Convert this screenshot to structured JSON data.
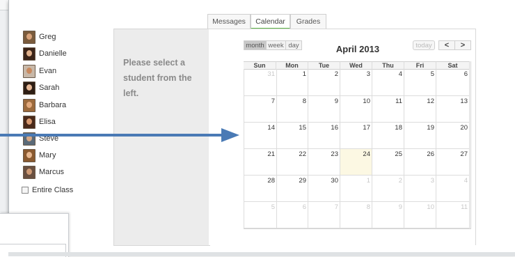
{
  "students": [
    {
      "name": "Greg",
      "avatar_bg": "#7a5b3c",
      "avatar_face": "#d8a27a"
    },
    {
      "name": "Danielle",
      "avatar_bg": "#3b2418",
      "avatar_face": "#e0b08a"
    },
    {
      "name": "Evan",
      "avatar_bg": "#c8b8a8",
      "avatar_face": "#c98a60"
    },
    {
      "name": "Sarah",
      "avatar_bg": "#2e1e14",
      "avatar_face": "#e6b795"
    },
    {
      "name": "Barbara",
      "avatar_bg": "#9c6a3c",
      "avatar_face": "#e2a97c"
    },
    {
      "name": "Elisa",
      "avatar_bg": "#4a2a1a",
      "avatar_face": "#d99a70"
    },
    {
      "name": "Steve",
      "avatar_bg": "#5a6a78",
      "avatar_face": "#d6a886"
    },
    {
      "name": "Mary",
      "avatar_bg": "#8a5a30",
      "avatar_face": "#e8b890"
    },
    {
      "name": "Marcus",
      "avatar_bg": "#6a5040",
      "avatar_face": "#cf9a74"
    }
  ],
  "entire_class_label": "Entire Class",
  "tabs": {
    "messages": "Messages",
    "calendar": "Calendar",
    "grades": "Grades"
  },
  "prompt": "Please select a student from the left.",
  "calendar": {
    "title": "April 2013",
    "view_month": "month",
    "view_week": "week",
    "view_day": "day",
    "today_label": "today",
    "prev_label": "<",
    "next_label": ">",
    "weekdays": [
      "Sun",
      "Mon",
      "Tue",
      "Wed",
      "Thu",
      "Fri",
      "Sat"
    ],
    "weeks": [
      [
        "31",
        "1",
        "2",
        "3",
        "4",
        "5",
        "6"
      ],
      [
        "7",
        "8",
        "9",
        "10",
        "11",
        "12",
        "13"
      ],
      [
        "14",
        "15",
        "16",
        "17",
        "18",
        "19",
        "20"
      ],
      [
        "21",
        "22",
        "23",
        "24",
        "25",
        "26",
        "27"
      ],
      [
        "28",
        "29",
        "30",
        "1",
        "2",
        "3",
        "4"
      ],
      [
        "5",
        "6",
        "7",
        "8",
        "9",
        "10",
        "11"
      ]
    ],
    "today_date": "24",
    "accent_color": "#5fb648",
    "today_color": "#fcf8e3"
  },
  "arrow": {
    "color": "#4a7ab5"
  }
}
